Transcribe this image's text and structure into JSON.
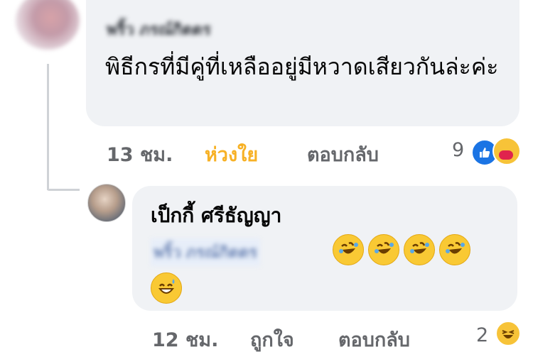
{
  "comment": {
    "author": "พริ้ว ภรณ์กิตตร",
    "text": "พิธีกรที่มีคู่ที่เหลืออยู่มีหวาดเสียวกันล่ะค่ะ",
    "time": "13 ชม.",
    "reaction_label": "ห่วงใย",
    "reply_label": "ตอบกลับ",
    "reaction_count": "9",
    "reaction_icons": [
      "like-icon",
      "care-icon"
    ]
  },
  "reply": {
    "author": "เป็กกี้ ศรีธัญญา",
    "mention": "พริ้ว ภรณ์กิตตร",
    "emojis": [
      "rolling-laugh-emoji",
      "rolling-laugh-emoji",
      "rolling-laugh-emoji",
      "rolling-laugh-emoji",
      "grinning-sweat-emoji"
    ],
    "time": "12 ชม.",
    "reaction_label": "ถูกใจ",
    "reply_label": "ตอบกลับ",
    "reaction_count": "2",
    "reaction_icons": [
      "haha-icon"
    ]
  },
  "colors": {
    "bubble": "#f0f2f5",
    "meta": "#65676b",
    "care_active": "#f7b125",
    "like_blue": "#1b74e4"
  }
}
